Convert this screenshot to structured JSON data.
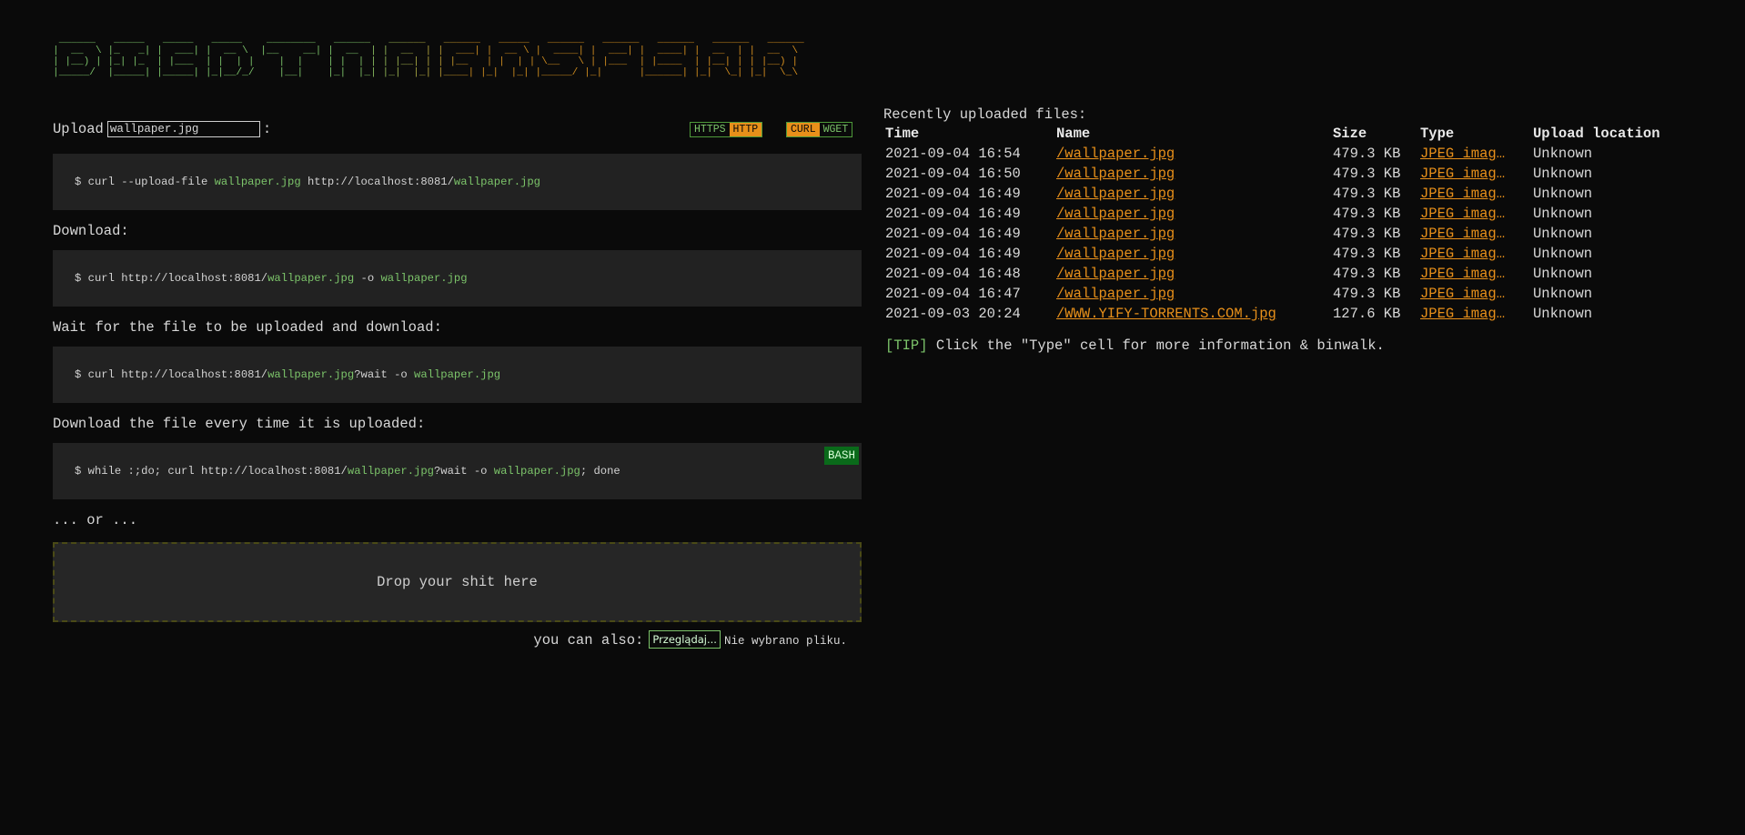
{
  "logo_ascii": " ______   _____   _____   _____    ________   ______   ______   ______   _____   ______   ______   ______   ______   ______ \n|  __  \\ |_   _| |  ___| |  __ \\  |__    __| |  __  | |  __  | |  ___| |  __ \\ |  ____| |  ___| |  ____| |  __  | |  __  \\\n| |__) | |_| |_  | |___  | |  | |    |  |    | |  | | | |__| | | |__   | |  | | \\__   \\ | |___  | |____  | |__| | | |__) |\n|_____/  |_____| |_____| |_|__/_/    |__|    |_|  |_| |_|  |_| |____| |_|  |_| |_____/ |_|      |______| |_|  \\_| |_|  \\_\\",
  "upload": {
    "label": "Upload",
    "filename": "wallpaper.jpg",
    "colon": ":"
  },
  "protocol_toggle": {
    "https": "HTTPS",
    "http": "HTTP"
  },
  "tool_toggle": {
    "curl": "CURL",
    "wget": "WGET"
  },
  "commands": {
    "upload": {
      "prefix": "$ curl --upload-file ",
      "file": "wallpaper.jpg",
      "mid": " http://localhost:8081/",
      "file2": "wallpaper.jpg"
    },
    "download_label": "Download:",
    "download": {
      "prefix": "$ curl http://localhost:8081/",
      "file": "wallpaper.jpg",
      "mid": " -o ",
      "file2": "wallpaper.jpg"
    },
    "wait_label": "Wait for the file to be uploaded and download:",
    "wait": {
      "prefix": "$ curl http://localhost:8081/",
      "file": "wallpaper.jpg",
      "mid": "?wait -o ",
      "file2": "wallpaper.jpg"
    },
    "loop_label": "Download the file every time it is uploaded:",
    "loop": {
      "prefix": "$ while :;do; curl http://localhost:8081/",
      "file": "wallpaper.jpg",
      "mid": "?wait -o ",
      "file2": "wallpaper.jpg",
      "suffix": "; done"
    },
    "bash_badge": "BASH"
  },
  "or_text": "... or ...",
  "dropzone_text": "Drop your shit here",
  "also": {
    "label": "you can also:",
    "browse_button": "Przeglądaj...",
    "no_file": "Nie wybrano pliku."
  },
  "recent": {
    "title": "Recently uploaded files:",
    "columns": [
      "Time",
      "Name",
      "Size",
      "Type",
      "Upload location"
    ],
    "rows": [
      {
        "time": "2021-09-04 16:54",
        "name": "/wallpaper.jpg",
        "size": "479.3 KB",
        "type": "JPEG image data",
        "location": "Unknown"
      },
      {
        "time": "2021-09-04 16:50",
        "name": "/wallpaper.jpg",
        "size": "479.3 KB",
        "type": "JPEG image data",
        "location": "Unknown"
      },
      {
        "time": "2021-09-04 16:49",
        "name": "/wallpaper.jpg",
        "size": "479.3 KB",
        "type": "JPEG image data",
        "location": "Unknown"
      },
      {
        "time": "2021-09-04 16:49",
        "name": "/wallpaper.jpg",
        "size": "479.3 KB",
        "type": "JPEG image data",
        "location": "Unknown"
      },
      {
        "time": "2021-09-04 16:49",
        "name": "/wallpaper.jpg",
        "size": "479.3 KB",
        "type": "JPEG image data",
        "location": "Unknown"
      },
      {
        "time": "2021-09-04 16:49",
        "name": "/wallpaper.jpg",
        "size": "479.3 KB",
        "type": "JPEG image data",
        "location": "Unknown"
      },
      {
        "time": "2021-09-04 16:48",
        "name": "/wallpaper.jpg",
        "size": "479.3 KB",
        "type": "JPEG image data",
        "location": "Unknown"
      },
      {
        "time": "2021-09-04 16:47",
        "name": "/wallpaper.jpg",
        "size": "479.3 KB",
        "type": "JPEG image data",
        "location": "Unknown"
      },
      {
        "time": "2021-09-03 20:24",
        "name": "/WWW.YIFY-TORRENTS.COM.jpg",
        "size": "127.6 KB",
        "type": "JPEG image data",
        "location": "Unknown"
      }
    ]
  },
  "tip": {
    "tag": "[TIP]",
    "text": " Click the \"Type\" cell for more information & binwalk."
  },
  "colors": {
    "background": "#0a0a0a",
    "accent_green": "#7cc46a",
    "accent_orange": "#e8901a",
    "code_block_bg": "#222222"
  }
}
